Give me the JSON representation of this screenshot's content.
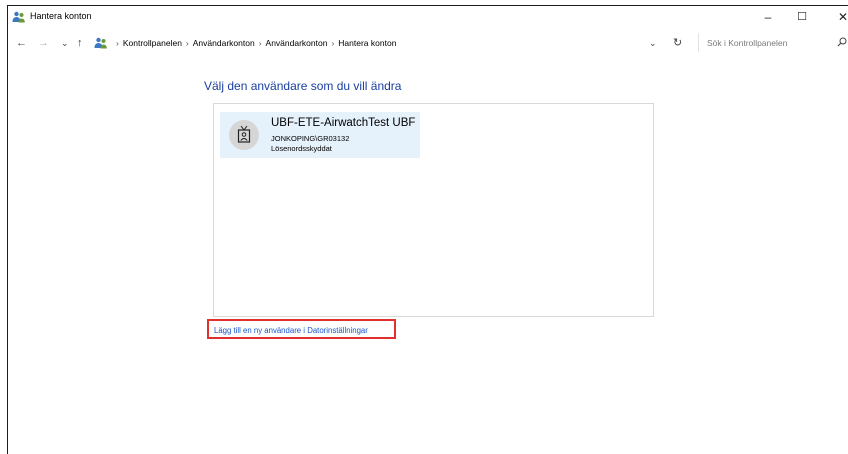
{
  "window": {
    "title": "Hantera konton",
    "controls": {
      "minimize": "–",
      "maximize": "☐",
      "close": "✕"
    }
  },
  "addressbar": {
    "back": "←",
    "forward": "→",
    "recent": "⌄",
    "up": "↑",
    "breadcrumbs": [
      "Kontrollpanelen",
      "Användarkonton",
      "Användarkonton",
      "Hantera konton"
    ],
    "separator": "›",
    "dropdown": "⌄",
    "refresh": "↻",
    "search_placeholder": "Sök i Kontrollpanelen",
    "search_icon_glyph": "⌕"
  },
  "main": {
    "heading": "Välj den användare som du vill ändra",
    "users": [
      {
        "name": "UBF-ETE-AirwatchTest UBF",
        "domain": "JONKOPING\\GR03132",
        "status": "Lösenordsskyddat"
      }
    ],
    "add_user_link": "Lägg till en ny användare i Datorinställningar"
  },
  "colors": {
    "heading": "#1a3ea1",
    "link": "#1a55c9",
    "tile_selected": "#e5f1fb",
    "highlight_box": "#e0312f"
  }
}
